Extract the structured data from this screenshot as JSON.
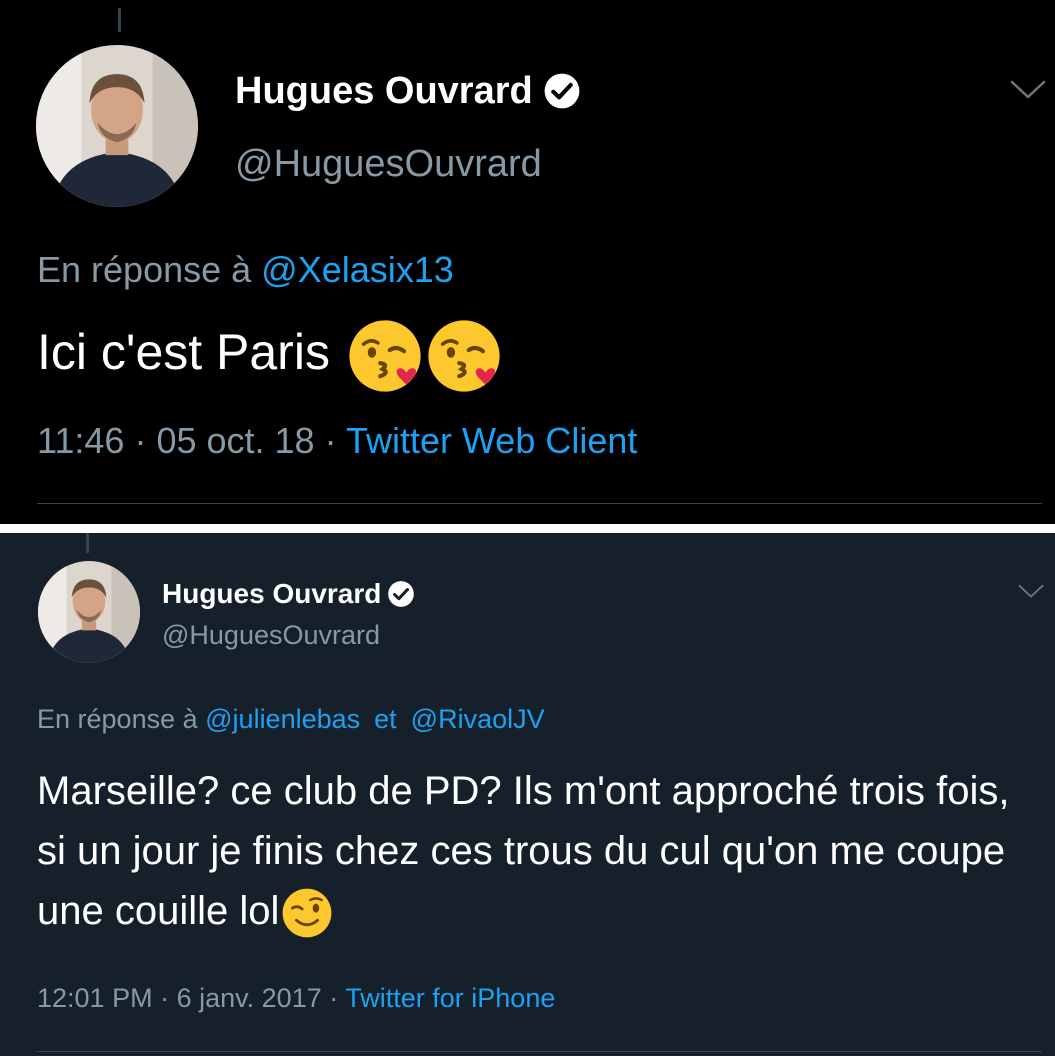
{
  "tweets": [
    {
      "author_name": "Hugues Ouvrard",
      "author_handle": "@HuguesOuvrard",
      "reply_prefix": "En réponse à",
      "reply_to": [
        "@Xelasix13"
      ],
      "text": "Ici c'est Paris",
      "emojis": [
        "kissing-heart-emoji",
        "kissing-heart-emoji"
      ],
      "time": "11:46",
      "date": "05 oct. 18",
      "source": "Twitter Web Client"
    },
    {
      "author_name": "Hugues Ouvrard",
      "author_handle": "@HuguesOuvrard",
      "reply_prefix": "En réponse à",
      "reply_to": [
        "@julienlebas",
        "@RivaolJV"
      ],
      "reply_joiner": "et",
      "text": "Marseille? ce club de PD? Ils m'ont approché trois fois, si un jour je finis chez ces trous du cul qu'on me coupe une couille lol",
      "emojis": [
        "winking-face-emoji"
      ],
      "time": "12:01 PM",
      "date": "6 janv. 2017",
      "source": "Twitter for iPhone"
    }
  ],
  "separator": "·",
  "icons": {
    "verified": "verified-badge-icon",
    "menu": "chevron-down-icon"
  },
  "colors": {
    "panel1_bg": "#000000",
    "panel2_bg": "#15202b",
    "link": "#1da1f2",
    "muted": "#8899a6",
    "text": "#ffffff"
  }
}
